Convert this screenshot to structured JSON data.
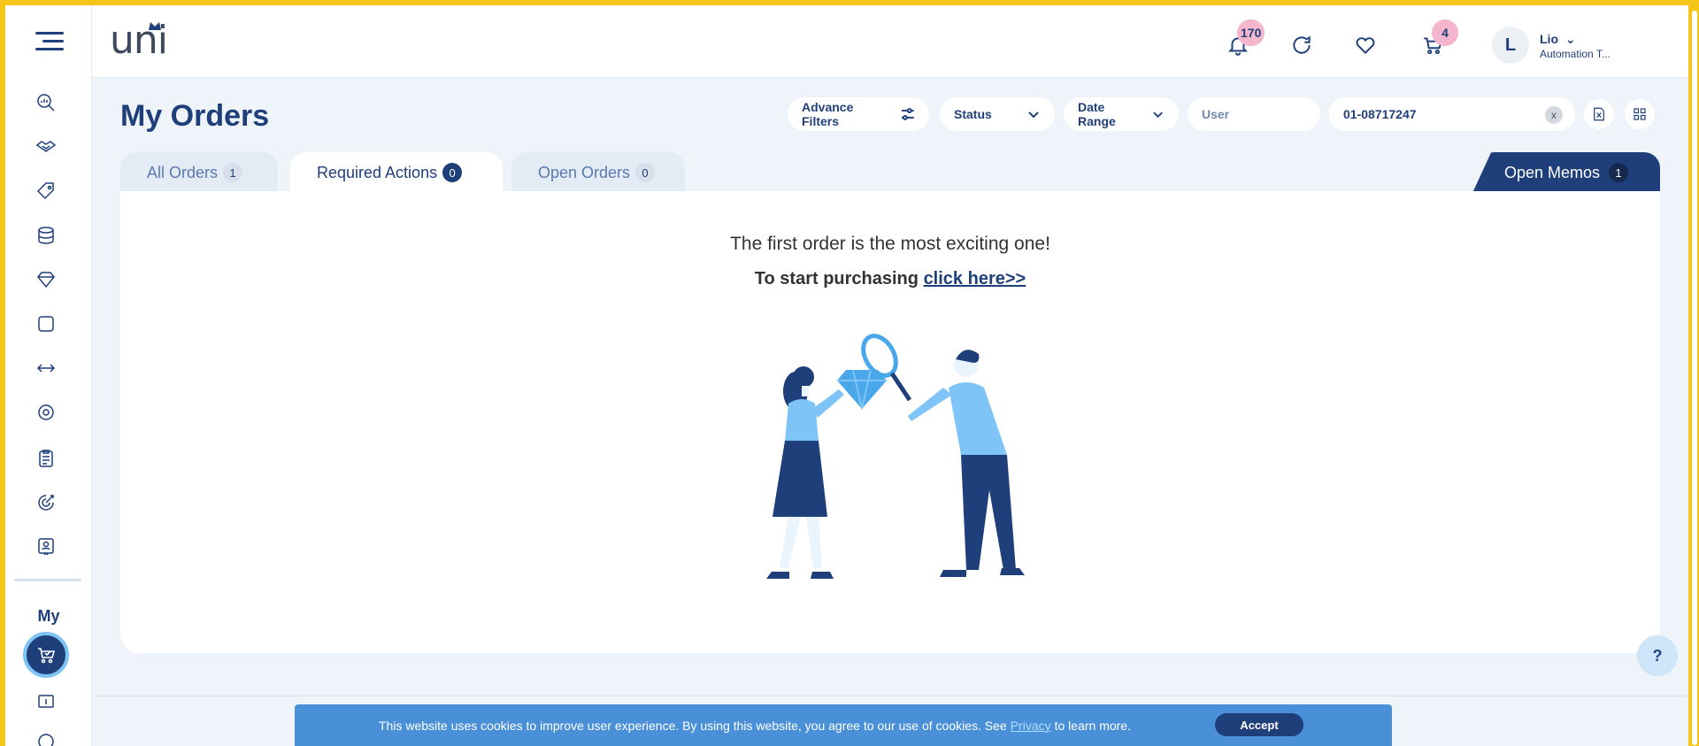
{
  "header": {
    "logo_text": "uni",
    "notifications_count": "170",
    "cart_count": "4",
    "user": {
      "initial": "L",
      "name": "Lio",
      "company": "Automation T..."
    }
  },
  "sidebar": {
    "section_label": "My",
    "icons": [
      "analytics-icon",
      "handshake-icon",
      "tag-icon",
      "database-icon",
      "diamond-icon",
      "tablet-icon",
      "swap-icon",
      "gear-badge-icon",
      "clipboard-icon",
      "target-icon",
      "contact-card-icon"
    ],
    "active_icon": "cart-check-icon"
  },
  "page": {
    "title": "My Orders"
  },
  "filters": {
    "advance_filters_label": "Advance Filters",
    "status_label": "Status",
    "date_range_label": "Date Range",
    "user_placeholder": "User",
    "search_value": "01-08717247",
    "clear_label": "x"
  },
  "tabs": [
    {
      "label": "All Orders",
      "count": "1"
    },
    {
      "label": "Required Actions",
      "count": "0"
    },
    {
      "label": "Open Orders",
      "count": "0"
    }
  ],
  "memo_tab": {
    "label": "Open Memos",
    "count": "1"
  },
  "empty_state": {
    "line1": "The first order is the most exciting one!",
    "line2_prefix": "To start purchasing",
    "link": "click here>>"
  },
  "help_label": "?",
  "cookie": {
    "text_before": "This website uses cookies to improve user experience. By using this website, you agree to our use of cookies. See",
    "link": "Privacy",
    "text_after": "to learn more.",
    "accept": "Accept"
  },
  "colors": {
    "brand": "#1f3f7a",
    "badge": "#f4b6cc",
    "cookie_bar": "#4a90d9",
    "frame": "#f5c518"
  }
}
